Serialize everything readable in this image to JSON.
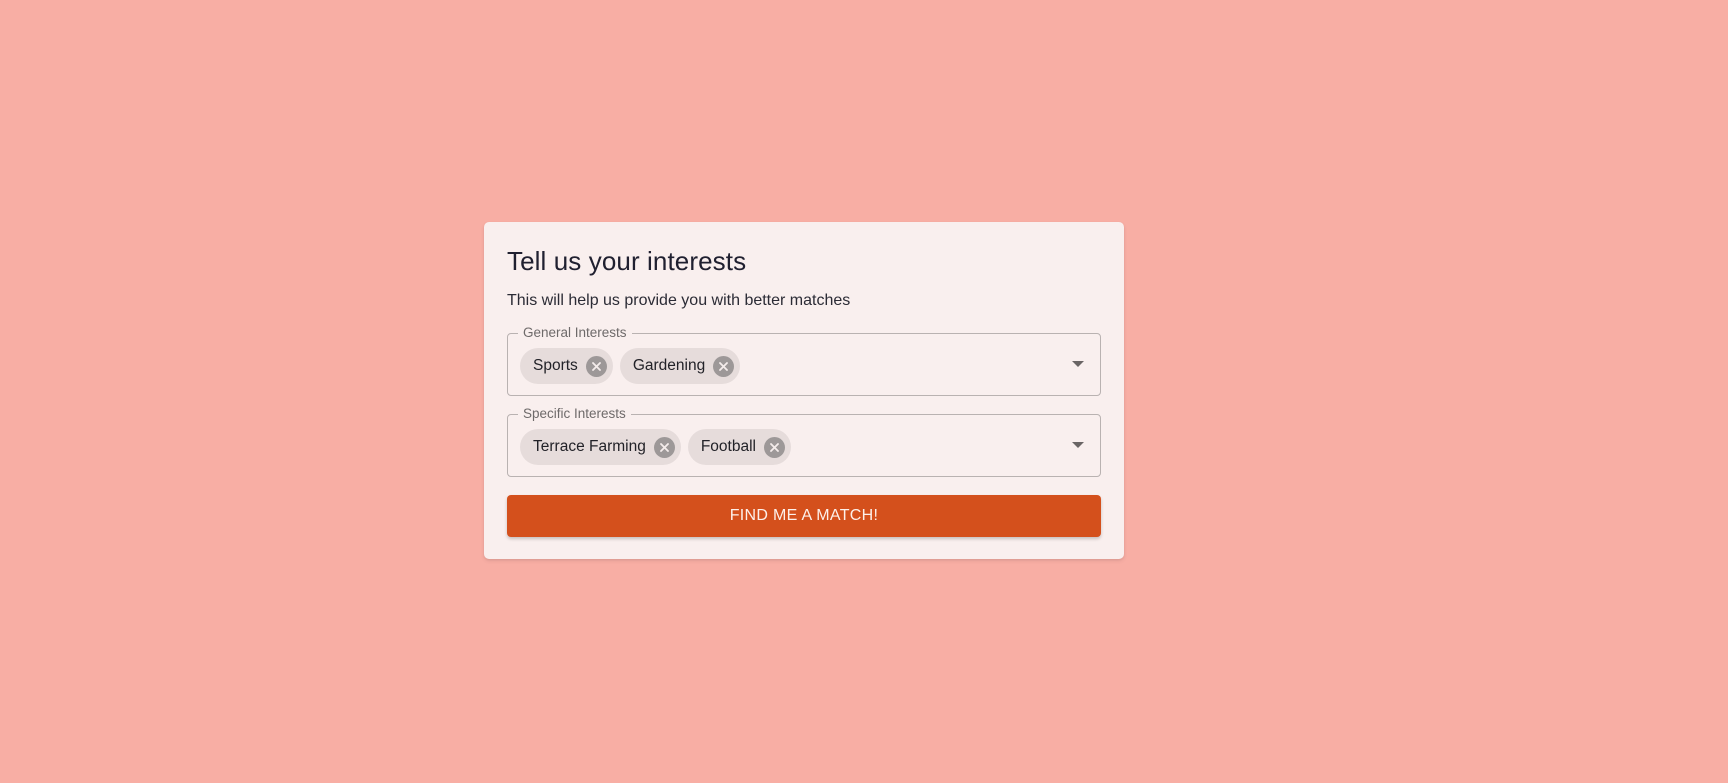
{
  "colors": {
    "background": "#f8aea4",
    "card": "#f9efee",
    "accent": "#d4501c",
    "chip": "#e6dcdb"
  },
  "form": {
    "title": "Tell us your interests",
    "subtitle": "This will help us provide you with better matches",
    "general": {
      "label": "General Interests",
      "chips": [
        {
          "label": "Sports",
          "delete_icon": "cancel-icon"
        },
        {
          "label": "Gardening",
          "delete_icon": "cancel-icon"
        }
      ]
    },
    "specific": {
      "label": "Specific Interests",
      "chips": [
        {
          "label": "Terrace Farming",
          "delete_icon": "cancel-icon"
        },
        {
          "label": "Football",
          "delete_icon": "cancel-icon"
        }
      ]
    },
    "submit_label": "FIND ME A MATCH!"
  }
}
